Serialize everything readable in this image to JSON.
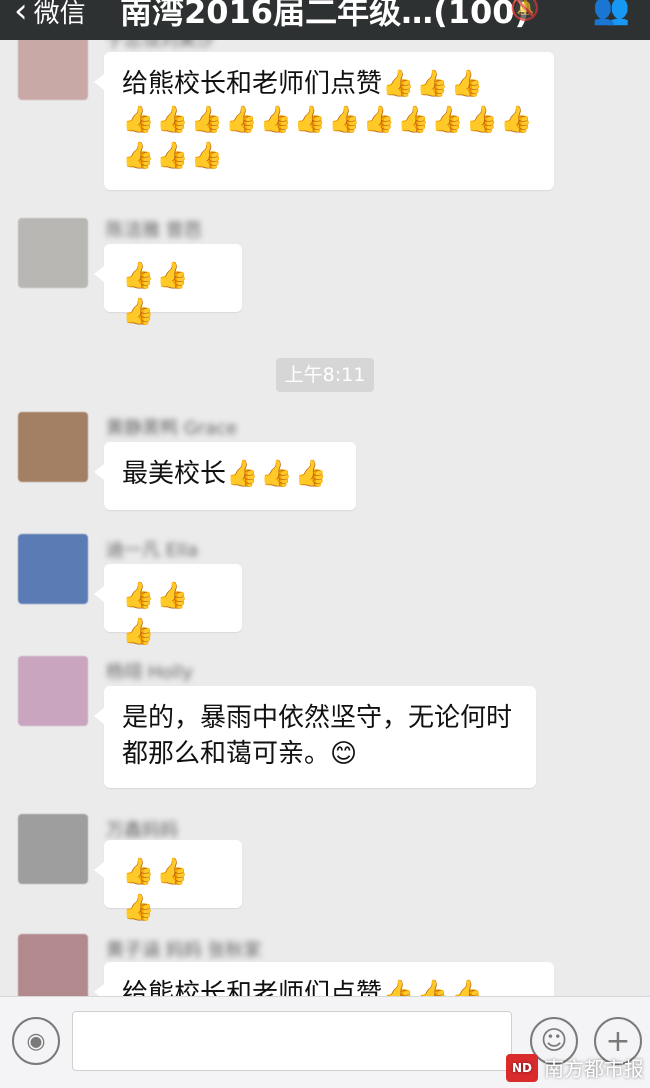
{
  "header": {
    "back_label": "微信",
    "title": "南湾2016届二年级…(100)",
    "mute_icon": "mute-icon",
    "contact_icon": "group-contacts-icon"
  },
  "messages": [
    {
      "sender": "于志恒刘美沙",
      "text": "给熊校长和老师们点赞",
      "thumbs": "👍👍👍\n👍👍👍👍👍👍👍👍👍👍👍👍\n👍👍👍",
      "avatar_color": "#c9a9a6"
    },
    {
      "sender": "陈洁雅 曾芭",
      "text": "",
      "thumbs": "👍👍👍",
      "avatar_color": "#b9b7b4"
    },
    {
      "sender": "黄静黑鸭 Grace",
      "text": "最美校长",
      "thumbs": "👍👍👍",
      "avatar_color": "#a37f64"
    },
    {
      "sender": "迪一凡 Ella",
      "text": "",
      "thumbs": "👍👍👍",
      "avatar_color": "#5b7bb5"
    },
    {
      "sender": "杨翊 Holly",
      "text": "是的，暴雨中依然坚守，无论何时都那么和蔼可亲。😊",
      "thumbs": "",
      "avatar_color": "#c9a5c0"
    },
    {
      "sender": "万鑫妈妈",
      "text": "",
      "thumbs": "👍👍👍",
      "avatar_color": "#9e9e9e"
    },
    {
      "sender": "黄子涵 妈妈 张秋家",
      "text": "给熊校长和老师们点赞",
      "thumbs": "👍👍👍",
      "avatar_color": "#b28a8e"
    }
  ],
  "timestamp": "上午8:11",
  "input": {
    "voice_icon": "voice-icon",
    "emoji_icon": "emoji-icon",
    "plus_icon": "plus-icon",
    "value": "",
    "placeholder": ""
  },
  "watermark": {
    "logo_text": "ND",
    "text": "南方都市报"
  },
  "colors": {
    "header_bg": "#2e3132",
    "chat_bg": "#ebebeb",
    "bubble_bg": "#ffffff",
    "timestamp_bg": "#d6d6d6"
  }
}
